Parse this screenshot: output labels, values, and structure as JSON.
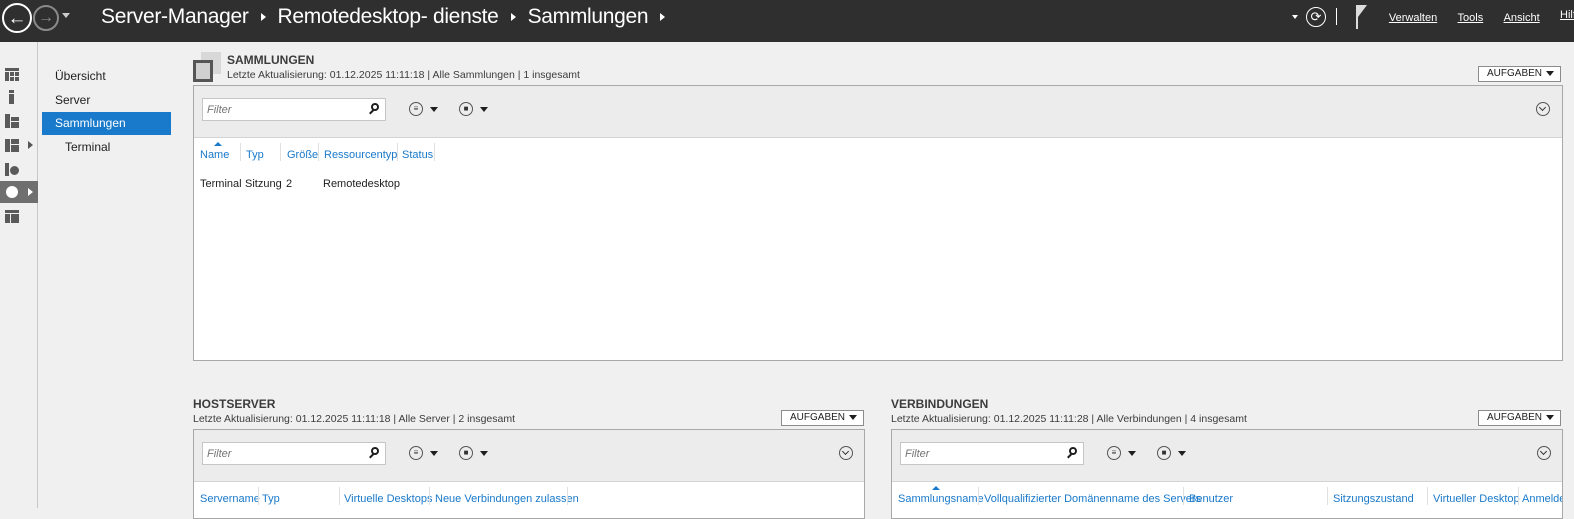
{
  "titlebar": {
    "breadcrumb": [
      "Server-Manager",
      "Remotedesktop- dienste",
      "Sammlungen"
    ],
    "refresh_icon": "refresh-icon",
    "flag_icon": "notifications-flag-icon",
    "menu": [
      "Verwalten",
      "Tools",
      "Ansicht",
      "Hilfe"
    ]
  },
  "iconstrip": [
    "dashboard-icon",
    "local-server-icon",
    "all-servers-icon",
    "file-services-icon",
    "iis-icon",
    "remote-desktop-services-icon",
    "wsus-icon"
  ],
  "nav": {
    "items": [
      "Übersicht",
      "Server",
      "Sammlungen",
      "Terminal"
    ],
    "selected": "Sammlungen",
    "selected_color": "#1979ca"
  },
  "sammlungen": {
    "title": "SAMMLUNGEN",
    "subtitle": "Letzte Aktualisierung: 01.12.2025 11:11:18 | Alle Sammlungen  | 1 insgesamt",
    "tasks_label": "AUFGABEN",
    "filter_placeholder": "Filter",
    "columns": [
      "Name",
      "Typ",
      "Größe",
      "Ressourcentyp",
      "Status"
    ],
    "rows": [
      [
        "Terminal",
        "Sitzung",
        "2",
        "Remotedesktop",
        ""
      ]
    ]
  },
  "hostserver": {
    "title": "HOSTSERVER",
    "subtitle": "Letzte Aktualisierung: 01.12.2025 11:11:18 | Alle Server  | 2 insgesamt",
    "tasks_label": "AUFGABEN",
    "filter_placeholder": "Filter",
    "columns": [
      "Servername",
      "Typ",
      "Virtuelle Desktops",
      "Neue Verbindungen zulassen"
    ]
  },
  "verbindungen": {
    "title": "VERBINDUNGEN",
    "subtitle": "Letzte Aktualisierung: 01.12.2025 11:11:28 | Alle Verbindungen  | 4 insgesamt",
    "tasks_label": "AUFGABEN",
    "filter_placeholder": "Filter",
    "columns": [
      "Sammlungsname",
      "Vollqualifizierter Domänenname des Servers",
      "Benutzer",
      "Sitzungszustand",
      "Virtueller Desktop",
      "Anmelde"
    ]
  }
}
